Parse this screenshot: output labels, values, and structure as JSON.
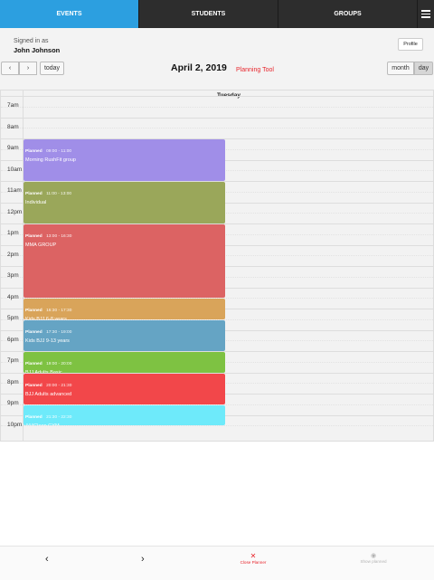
{
  "tabs": [
    {
      "label": "EVENTS",
      "active": true
    },
    {
      "label": "STUDENTS",
      "active": false
    },
    {
      "label": "GROUPS",
      "active": false
    }
  ],
  "menu_icon": "hamburger-menu-icon",
  "user": {
    "signed_in_label": "Signed in as",
    "name": "John Johnson",
    "profile_button": "Profile"
  },
  "toolbar": {
    "prev_label": "‹",
    "next_label": "›",
    "today_label": "today",
    "date_title": "April 2, 2019",
    "planning_tool_label": "Planning Tool",
    "month_label": "month",
    "day_label": "day",
    "active_view": "day"
  },
  "calendar": {
    "day_header": "Tuesday",
    "hour_labels": [
      "7am",
      "8am",
      "9am",
      "10am",
      "11am",
      "12pm",
      "1pm",
      "2pm",
      "3pm",
      "4pm",
      "5pm",
      "6pm",
      "7pm",
      "8pm",
      "9pm",
      "10pm"
    ],
    "events": [
      {
        "status": "Planned",
        "time": "09:00 - 11:00",
        "title": "Morning RushFit group",
        "color": "#a08ee8"
      },
      {
        "status": "Planned",
        "time": "11:00 - 13:00",
        "title": "Individual",
        "color": "#9aa75a"
      },
      {
        "status": "Planned",
        "time": "13:00 - 16:30",
        "title": "MMA GROUP",
        "color": "#dc6363"
      },
      {
        "status": "Planned",
        "time": "16:30 - 17:30",
        "title": "Kids BJJ 6-8 years",
        "color": "#d9a45a"
      },
      {
        "status": "Planned",
        "time": "17:30 - 19:00",
        "title": "Kids BJJ 9-13 years",
        "color": "#65a4c4"
      },
      {
        "status": "Planned",
        "time": "19:00 - 20:00",
        "title": "BJJ Adults Basic",
        "color": "#7ec242"
      },
      {
        "status": "Planned",
        "time": "20:00 - 21:30",
        "title": "BJJ Adults advanced",
        "color": "#f2474a"
      },
      {
        "status": "Planned",
        "time": "21:30 - 22:30",
        "title": "444Clean GYM",
        "color": "#6eeafa"
      }
    ]
  },
  "bottom": {
    "prev_icon": "‹",
    "next_icon": "›",
    "close_planner_icon": "✕",
    "close_planner_label": "Close Planner",
    "show_planned_icon": "◉",
    "show_planned_label": "Show planned"
  }
}
